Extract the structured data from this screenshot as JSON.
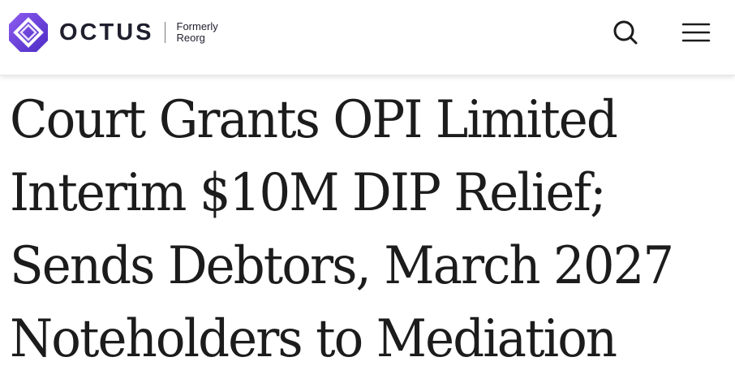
{
  "header": {
    "logo": {
      "wordmark": "OCTUS",
      "formerly_line1": "Formerly",
      "formerly_line2": "Reorg",
      "brand_color": "#7b4fe0",
      "brand_color_dark": "#4b2bc4",
      "icon": "octus-logo-icon"
    },
    "search": {
      "icon": "search-icon"
    },
    "menu": {
      "icon": "hamburger-menu-icon"
    }
  },
  "article": {
    "headline_lines": [
      "Court Grants OPI Limited",
      "Interim $10M DIP Relief;",
      "Sends Debtors, March 2027",
      "Noteholders to Mediation"
    ]
  }
}
